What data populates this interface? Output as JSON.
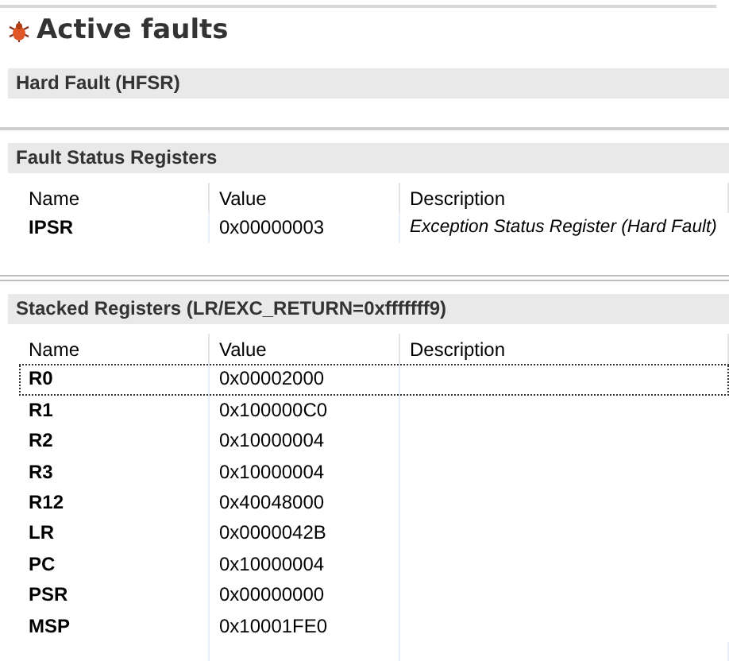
{
  "title": "Active faults",
  "sections": [
    {
      "heading": "Hard Fault (HFSR)"
    },
    {
      "heading": "Fault Status Registers",
      "columns": [
        "Name",
        "Value",
        "Description"
      ],
      "rows": [
        {
          "name": "IPSR",
          "value": "0x00000003",
          "description": "Exception Status Register (Hard Fault)",
          "selected": false
        }
      ]
    },
    {
      "heading": "Stacked Registers (LR/EXC_RETURN=0xfffffff9)",
      "columns": [
        "Name",
        "Value",
        "Description"
      ],
      "rows": [
        {
          "name": "R0",
          "value": "0x00002000",
          "selected": true
        },
        {
          "name": "R1",
          "value": "0x100000C0",
          "selected": false
        },
        {
          "name": "R2",
          "value": "0x10000004",
          "selected": false
        },
        {
          "name": "R3",
          "value": "0x10000004",
          "selected": false
        },
        {
          "name": "R12",
          "value": "0x40048000",
          "selected": false
        },
        {
          "name": "LR",
          "value": "0x0000042B",
          "selected": false
        },
        {
          "name": "PC",
          "value": "0x10000004",
          "selected": false
        },
        {
          "name": "PSR",
          "value": "0x00000000",
          "selected": false
        },
        {
          "name": "MSP",
          "value": "0x10001FE0",
          "selected": false
        }
      ]
    }
  ]
}
